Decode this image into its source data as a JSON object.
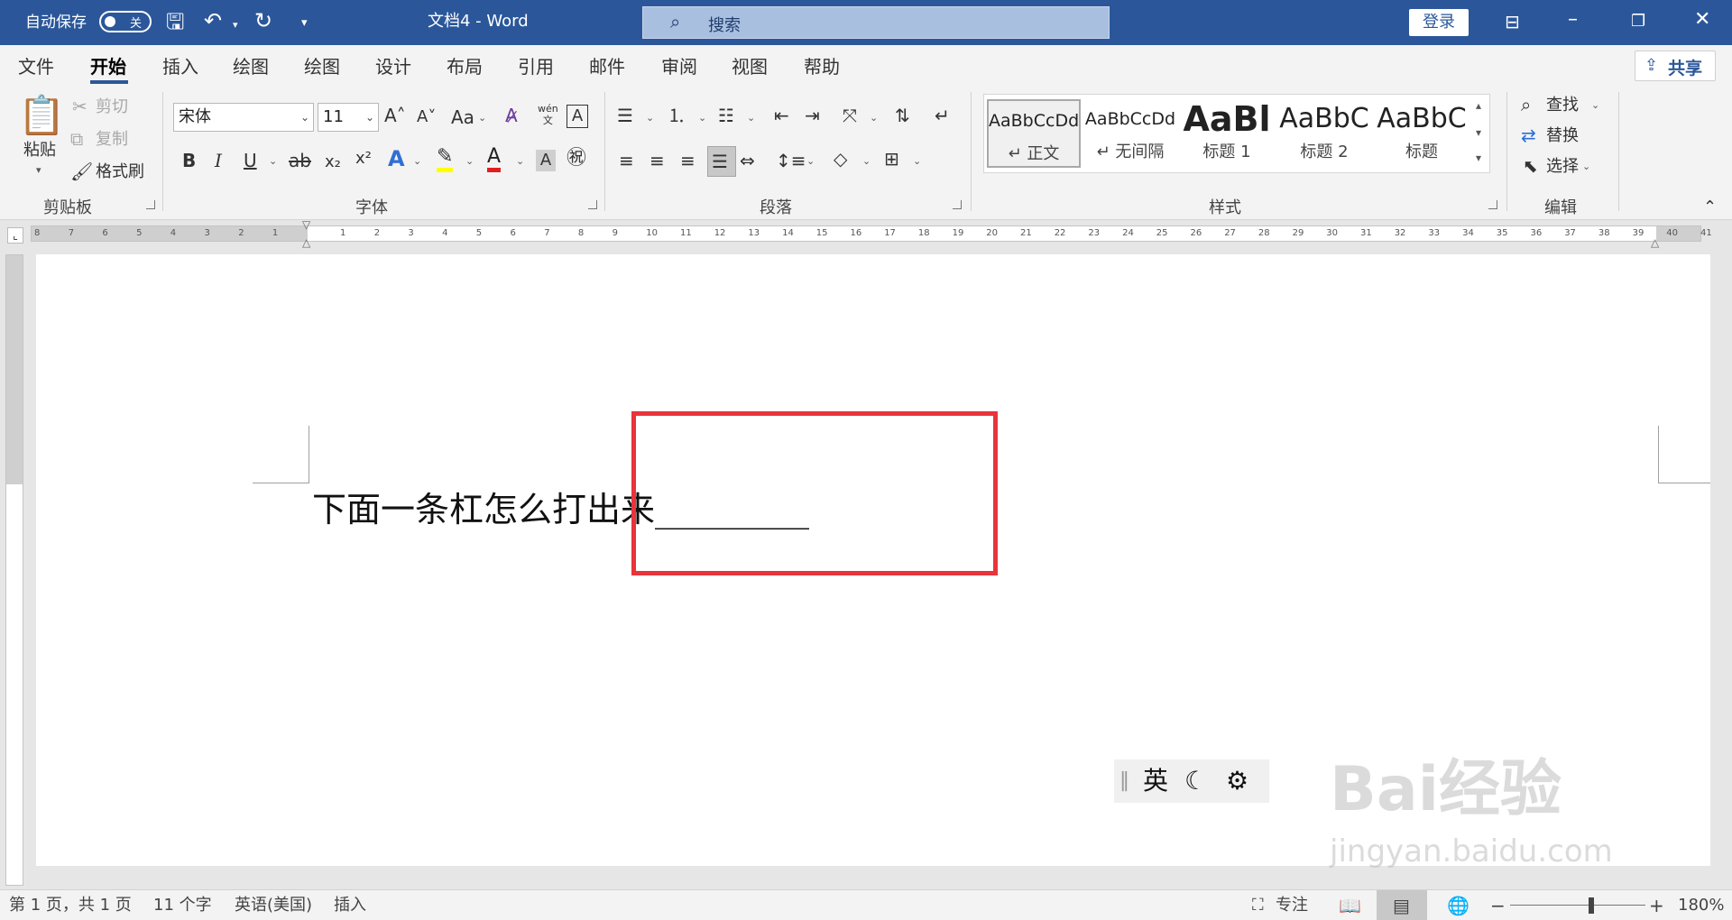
{
  "app": {
    "title": "文档4 - Word",
    "autosave_label": "自动保存",
    "autosave_toggle": "关"
  },
  "search": {
    "placeholder": "搜索"
  },
  "account": {
    "login_label": "登录",
    "share_label": "共享"
  },
  "tabs": [
    "文件",
    "开始",
    "插入",
    "绘图",
    "绘图",
    "设计",
    "布局",
    "引用",
    "邮件",
    "审阅",
    "视图",
    "帮助"
  ],
  "clipboard": {
    "paste": "粘贴",
    "cut": "剪切",
    "copy": "复制",
    "format_painter": "格式刷",
    "group": "剪贴板"
  },
  "font": {
    "name": "宋体",
    "size": "11",
    "group": "字体",
    "case_label": "Aa",
    "phonetic": "wén",
    "phonetic_char": "文"
  },
  "paragraph": {
    "group": "段落"
  },
  "styles": {
    "group": "样式",
    "items": [
      {
        "preview": "AaBbCcDd",
        "name": "正文"
      },
      {
        "preview": "AaBbCcDd",
        "name": "无间隔"
      },
      {
        "preview": "AaBl",
        "name": "标题 1"
      },
      {
        "preview": "AaBbC",
        "name": "标题 2"
      },
      {
        "preview": "AaBbC",
        "name": "标题"
      }
    ]
  },
  "editing": {
    "find": "查找",
    "replace": "替换",
    "select": "选择",
    "group": "编辑"
  },
  "ruler": {
    "left_numbers": [
      "8",
      "7",
      "6",
      "5",
      "4",
      "3",
      "2",
      "1"
    ],
    "right_numbers": [
      "1",
      "2",
      "3",
      "4",
      "5",
      "6",
      "7",
      "8",
      "9",
      "10",
      "11",
      "12",
      "13",
      "14",
      "15",
      "16",
      "17",
      "18",
      "19",
      "20",
      "21",
      "22",
      "23",
      "24",
      "25",
      "26",
      "27",
      "28",
      "29",
      "30",
      "31",
      "32",
      "33",
      "34",
      "35",
      "36",
      "37",
      "38",
      "39",
      "40",
      "41"
    ]
  },
  "document": {
    "text": "下面一条杠怎么打出来",
    "underline": "_________"
  },
  "ime": {
    "lang": "英"
  },
  "watermark": {
    "brand": "Bai经验",
    "url": "jingyan.baidu.com"
  },
  "status": {
    "page": "第 1 页，共 1 页",
    "words": "11 个字",
    "language": "英语(美国)",
    "mode": "插入",
    "focus": "专注",
    "zoom": "180%",
    "zoom_level": 0.6
  }
}
